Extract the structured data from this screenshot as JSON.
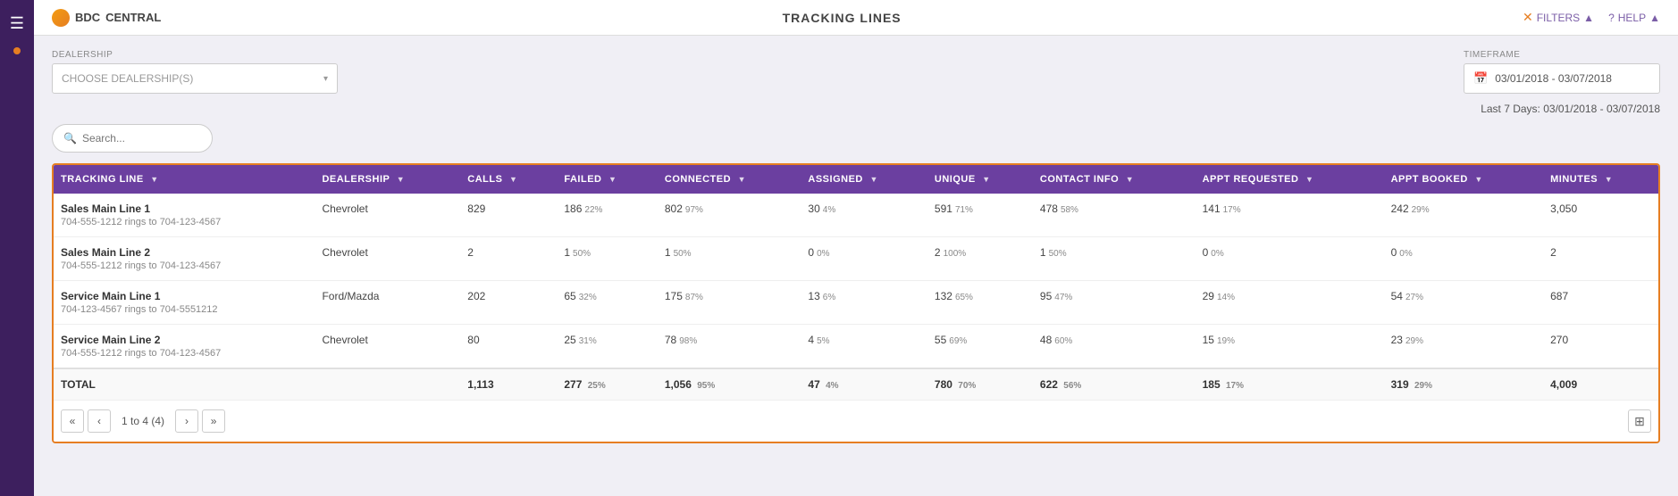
{
  "app": {
    "title": "TRACKING LINES",
    "logo_text": "BDC",
    "logo_subtitle": "CENTRAL"
  },
  "topbar": {
    "filters_label": "FILTERS",
    "help_label": "HELP"
  },
  "filters": {
    "dealership_label": "DEALERSHIP",
    "dealership_placeholder": "CHOOSE DEALERSHIP(S)",
    "timeframe_label": "TIMEFRAME",
    "timeframe_value": "03/01/2018 - 03/07/2018",
    "date_range_display": "Last 7 Days: 03/01/2018 - 03/07/2018"
  },
  "search": {
    "placeholder": "Search..."
  },
  "table": {
    "columns": [
      {
        "id": "tracking_line",
        "label": "TRACKING LINE"
      },
      {
        "id": "dealership",
        "label": "DEALERSHIP"
      },
      {
        "id": "calls",
        "label": "CALLS"
      },
      {
        "id": "failed",
        "label": "FAILED"
      },
      {
        "id": "connected",
        "label": "CONNECTED"
      },
      {
        "id": "assigned",
        "label": "ASSIGNED"
      },
      {
        "id": "unique",
        "label": "UNIQUE"
      },
      {
        "id": "contact_info",
        "label": "CONTACT INFO"
      },
      {
        "id": "appt_requested",
        "label": "APPT REQUESTED"
      },
      {
        "id": "appt_booked",
        "label": "APPT BOOKED"
      },
      {
        "id": "minutes",
        "label": "MINUTES"
      }
    ],
    "rows": [
      {
        "name": "Sales Main Line 1",
        "sub": "704-555-1212 rings to 704-123-4567",
        "dealership": "Chevrolet",
        "calls": "829",
        "failed": "186",
        "failed_pct": "22%",
        "connected": "802",
        "connected_pct": "97%",
        "assigned": "30",
        "assigned_pct": "4%",
        "unique": "591",
        "unique_pct": "71%",
        "contact_info": "478",
        "contact_info_pct": "58%",
        "appt_requested": "141",
        "appt_requested_pct": "17%",
        "appt_booked": "242",
        "appt_booked_pct": "29%",
        "minutes": "3,050"
      },
      {
        "name": "Sales Main Line 2",
        "sub": "704-555-1212 rings to 704-123-4567",
        "dealership": "Chevrolet",
        "calls": "2",
        "failed": "1",
        "failed_pct": "50%",
        "connected": "1",
        "connected_pct": "50%",
        "assigned": "0",
        "assigned_pct": "0%",
        "unique": "2",
        "unique_pct": "100%",
        "contact_info": "1",
        "contact_info_pct": "50%",
        "appt_requested": "0",
        "appt_requested_pct": "0%",
        "appt_booked": "0",
        "appt_booked_pct": "0%",
        "minutes": "2"
      },
      {
        "name": "Service Main Line 1",
        "sub": "704-123-4567 rings to 704-5551212",
        "dealership": "Ford/Mazda",
        "calls": "202",
        "failed": "65",
        "failed_pct": "32%",
        "connected": "175",
        "connected_pct": "87%",
        "assigned": "13",
        "assigned_pct": "6%",
        "unique": "132",
        "unique_pct": "65%",
        "contact_info": "95",
        "contact_info_pct": "47%",
        "appt_requested": "29",
        "appt_requested_pct": "14%",
        "appt_booked": "54",
        "appt_booked_pct": "27%",
        "minutes": "687"
      },
      {
        "name": "Service Main Line 2",
        "sub": "704-555-1212 rings to 704-123-4567",
        "dealership": "Chevrolet",
        "calls": "80",
        "failed": "25",
        "failed_pct": "31%",
        "connected": "78",
        "connected_pct": "98%",
        "assigned": "4",
        "assigned_pct": "5%",
        "unique": "55",
        "unique_pct": "69%",
        "contact_info": "48",
        "contact_info_pct": "60%",
        "appt_requested": "15",
        "appt_requested_pct": "19%",
        "appt_booked": "23",
        "appt_booked_pct": "29%",
        "minutes": "270"
      }
    ],
    "totals": {
      "label": "TOTAL",
      "calls": "1,113",
      "failed": "277",
      "failed_pct": "25%",
      "connected": "1,056",
      "connected_pct": "95%",
      "assigned": "47",
      "assigned_pct": "4%",
      "unique": "780",
      "unique_pct": "70%",
      "contact_info": "622",
      "contact_info_pct": "56%",
      "appt_requested": "185",
      "appt_requested_pct": "17%",
      "appt_booked": "319",
      "appt_booked_pct": "29%",
      "minutes": "4,009"
    }
  },
  "pagination": {
    "info": "1 to 4 (4)"
  }
}
